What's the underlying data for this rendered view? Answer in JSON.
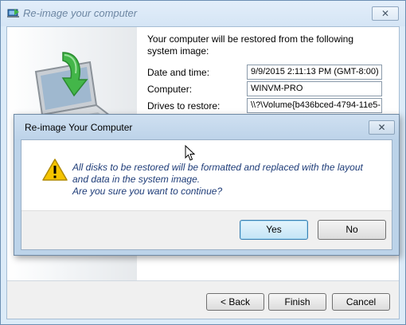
{
  "outer_window": {
    "title": "Re-image your computer",
    "close_glyph": "✕",
    "intro": "Your computer will be restored from the following system image:",
    "fields": [
      {
        "label": "Date and time:",
        "value": "9/9/2015 2:11:13 PM (GMT-8:00)"
      },
      {
        "label": "Computer:",
        "value": "WINVM-PRO"
      },
      {
        "label": "Drives to restore:",
        "value": "\\\\?\\Volume{b436bced-4794-11e5-"
      }
    ],
    "buttons": {
      "back": "< Back",
      "finish": "Finish",
      "cancel": "Cancel"
    }
  },
  "dialog": {
    "title": "Re-image Your Computer",
    "close_glyph": "✕",
    "message_lines": [
      "All disks to be restored will be formatted and replaced with the layout",
      "and data in the system image.",
      "Are you sure you want to continue?"
    ],
    "buttons": {
      "yes": "Yes",
      "no": "No"
    }
  },
  "icons": {
    "title_icon": "system-restore-icon",
    "illustration": "laptop-restore-arrow-icon",
    "warning": "warning-icon",
    "cursor": "mouse-pointer"
  },
  "colors": {
    "window_frame": "#dcebf8",
    "dialog_frame": "#bcd3e9",
    "message_text": "#1e3c78",
    "default_button_border": "#3c7fb1",
    "warning_yellow": "#f5c400"
  }
}
